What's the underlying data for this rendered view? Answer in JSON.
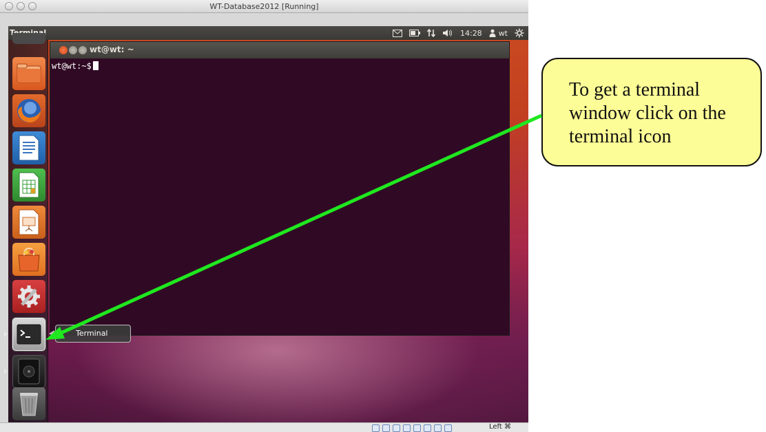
{
  "host_window": {
    "title": "WT-Database2012 [Running]"
  },
  "top_panel": {
    "app_name": "Terminal",
    "clock": "14:28",
    "user": "wt"
  },
  "launcher": {
    "items": [
      {
        "name": "files",
        "icon": "folder-icon"
      },
      {
        "name": "firefox",
        "icon": "firefox-icon"
      },
      {
        "name": "writer",
        "icon": "writer-document-icon"
      },
      {
        "name": "calc",
        "icon": "calc-spreadsheet-icon"
      },
      {
        "name": "impress",
        "icon": "impress-presentation-icon"
      },
      {
        "name": "software-center",
        "icon": "software-center-bag-icon"
      },
      {
        "name": "system-settings",
        "icon": "settings-wrench-icon"
      },
      {
        "name": "terminal",
        "icon": "terminal-icon"
      },
      {
        "name": "dvd",
        "icon": "disc-drive-icon"
      },
      {
        "name": "trash",
        "icon": "trash-icon"
      }
    ]
  },
  "terminal": {
    "title": "wt@wt: ~",
    "prompt": "wt@wt:~$"
  },
  "tooltip": {
    "label": "Terminal"
  },
  "statusbar": {
    "host_key": "Left ⌘"
  },
  "annotation": {
    "callout_text": "To get a terminal window click on the terminal icon",
    "arrow_color": "#1fe81f",
    "callout_color": "#fdfd97"
  },
  "colors": {
    "terminal_bg": "#300a24",
    "panel_bg": "#3c3b37",
    "close_button": "#e25b2e"
  }
}
